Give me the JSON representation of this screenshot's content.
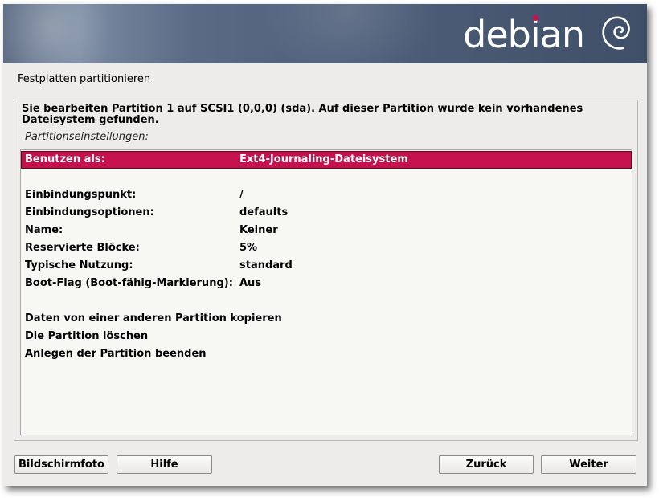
{
  "banner": {
    "logo_text": "debian"
  },
  "dialog": {
    "title": "Festplatten partitionieren",
    "description": "Sie bearbeiten Partition 1 auf SCSI1 (0,0,0) (sda). Auf dieser Partition wurde kein vorhandenes Dateisystem gefunden.",
    "settings_label": "Partitionseinstellungen:"
  },
  "settings": [
    {
      "key": "Benutzen als:",
      "value": "Ext4-Journaling-Dateisystem",
      "selected": true
    },
    {
      "key": "Einbindungspunkt:",
      "value": "/"
    },
    {
      "key": "Einbindungsoptionen:",
      "value": "defaults"
    },
    {
      "key": "Name:",
      "value": "Keiner"
    },
    {
      "key": "Reservierte Blöcke:",
      "value": "5%"
    },
    {
      "key": "Typische Nutzung:",
      "value": "standard"
    },
    {
      "key": "Boot-Flag (Boot-fähig-Markierung):",
      "value": "Aus"
    }
  ],
  "actions": [
    {
      "label": "Daten von einer anderen Partition kopieren"
    },
    {
      "label": "Die Partition löschen"
    },
    {
      "label": "Anlegen der Partition beenden"
    }
  ],
  "buttons": {
    "screenshot": "Bildschirmfoto",
    "help": "Hilfe",
    "back": "Zurück",
    "next": "Weiter"
  },
  "colors": {
    "selection": "#c5124f",
    "banner": "#4f5f7a",
    "debian_red": "#d70751"
  }
}
